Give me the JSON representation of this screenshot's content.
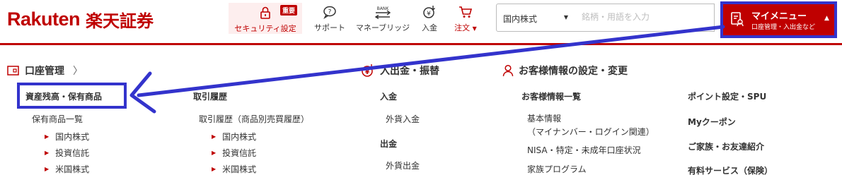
{
  "header": {
    "logo_en": "Rakuten",
    "logo_jp": "楽天証券",
    "nav": {
      "security": {
        "label": "セキュリティ設定",
        "badge": "重要",
        "icon": "lock-icon"
      },
      "support": {
        "label": "サポート",
        "icon": "support-chat-icon"
      },
      "money_bridge": {
        "label": "マネーブリッジ",
        "icon_text": "BANK",
        "icon": "bank-transfer-icon"
      },
      "deposit": {
        "label": "入金",
        "icon": "yen-deposit-icon"
      },
      "order": {
        "label": "注文",
        "icon": "cart-icon",
        "caret": "▼"
      }
    },
    "search": {
      "market_select": "国内株式",
      "placeholder": "銘柄・用語を入力"
    },
    "my_menu": {
      "title": "マイメニュー",
      "subtitle": "口座管理・入出金など",
      "caret": "▲"
    },
    "colors": {
      "brand": "#bf0000",
      "annotation": "#3333cc"
    }
  },
  "menu": {
    "account": {
      "heading": "口座管理",
      "chevron": "〉",
      "assets_heading": "資産残高・保有商品",
      "holdings_label": "保有商品一覧",
      "holdings_items": [
        "国内株式",
        "投資信託",
        "米国株式"
      ]
    },
    "trades": {
      "heading": "取引履歴",
      "sub_label": "取引履歴（商品別売買履歴）",
      "items": [
        "国内株式",
        "投資信託",
        "米国株式"
      ]
    },
    "money": {
      "heading": "入出金・振替",
      "deposit_heading": "入金",
      "fx_deposit": "外貨入金",
      "withdraw_heading": "出金",
      "fx_withdraw": "外貨出金"
    },
    "customer": {
      "heading": "お客様情報の設定・変更",
      "list_heading": "お客様情報一覧",
      "basic_info": "基本情報",
      "basic_info_sub": "（マイナンバー・ログイン関連）",
      "nisa": "NISA・特定・未成年口座状況",
      "family_program": "家族プログラム"
    },
    "other": {
      "points": "ポイント設定・SPU",
      "coupon": "Myクーポン",
      "family_referral": "ご家族・お友達紹介",
      "paid_service": "有料サービス（保険）"
    }
  }
}
